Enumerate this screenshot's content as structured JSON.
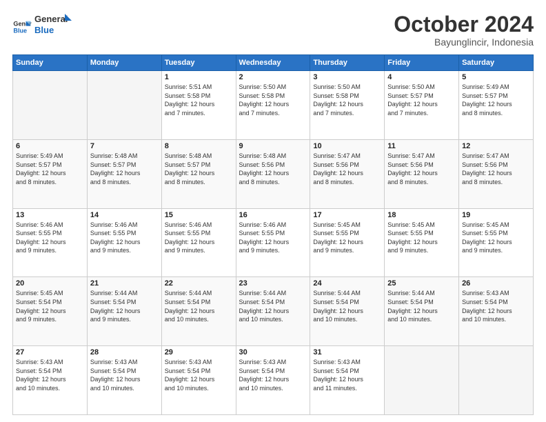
{
  "header": {
    "logo_line1": "General",
    "logo_line2": "Blue",
    "month": "October 2024",
    "location": "Bayunglincir, Indonesia"
  },
  "days_of_week": [
    "Sunday",
    "Monday",
    "Tuesday",
    "Wednesday",
    "Thursday",
    "Friday",
    "Saturday"
  ],
  "weeks": [
    [
      {
        "day": "",
        "info": ""
      },
      {
        "day": "",
        "info": ""
      },
      {
        "day": "1",
        "info": "Sunrise: 5:51 AM\nSunset: 5:58 PM\nDaylight: 12 hours\nand 7 minutes."
      },
      {
        "day": "2",
        "info": "Sunrise: 5:50 AM\nSunset: 5:58 PM\nDaylight: 12 hours\nand 7 minutes."
      },
      {
        "day": "3",
        "info": "Sunrise: 5:50 AM\nSunset: 5:58 PM\nDaylight: 12 hours\nand 7 minutes."
      },
      {
        "day": "4",
        "info": "Sunrise: 5:50 AM\nSunset: 5:57 PM\nDaylight: 12 hours\nand 7 minutes."
      },
      {
        "day": "5",
        "info": "Sunrise: 5:49 AM\nSunset: 5:57 PM\nDaylight: 12 hours\nand 8 minutes."
      }
    ],
    [
      {
        "day": "6",
        "info": "Sunrise: 5:49 AM\nSunset: 5:57 PM\nDaylight: 12 hours\nand 8 minutes."
      },
      {
        "day": "7",
        "info": "Sunrise: 5:48 AM\nSunset: 5:57 PM\nDaylight: 12 hours\nand 8 minutes."
      },
      {
        "day": "8",
        "info": "Sunrise: 5:48 AM\nSunset: 5:57 PM\nDaylight: 12 hours\nand 8 minutes."
      },
      {
        "day": "9",
        "info": "Sunrise: 5:48 AM\nSunset: 5:56 PM\nDaylight: 12 hours\nand 8 minutes."
      },
      {
        "day": "10",
        "info": "Sunrise: 5:47 AM\nSunset: 5:56 PM\nDaylight: 12 hours\nand 8 minutes."
      },
      {
        "day": "11",
        "info": "Sunrise: 5:47 AM\nSunset: 5:56 PM\nDaylight: 12 hours\nand 8 minutes."
      },
      {
        "day": "12",
        "info": "Sunrise: 5:47 AM\nSunset: 5:56 PM\nDaylight: 12 hours\nand 8 minutes."
      }
    ],
    [
      {
        "day": "13",
        "info": "Sunrise: 5:46 AM\nSunset: 5:55 PM\nDaylight: 12 hours\nand 9 minutes."
      },
      {
        "day": "14",
        "info": "Sunrise: 5:46 AM\nSunset: 5:55 PM\nDaylight: 12 hours\nand 9 minutes."
      },
      {
        "day": "15",
        "info": "Sunrise: 5:46 AM\nSunset: 5:55 PM\nDaylight: 12 hours\nand 9 minutes."
      },
      {
        "day": "16",
        "info": "Sunrise: 5:46 AM\nSunset: 5:55 PM\nDaylight: 12 hours\nand 9 minutes."
      },
      {
        "day": "17",
        "info": "Sunrise: 5:45 AM\nSunset: 5:55 PM\nDaylight: 12 hours\nand 9 minutes."
      },
      {
        "day": "18",
        "info": "Sunrise: 5:45 AM\nSunset: 5:55 PM\nDaylight: 12 hours\nand 9 minutes."
      },
      {
        "day": "19",
        "info": "Sunrise: 5:45 AM\nSunset: 5:55 PM\nDaylight: 12 hours\nand 9 minutes."
      }
    ],
    [
      {
        "day": "20",
        "info": "Sunrise: 5:45 AM\nSunset: 5:54 PM\nDaylight: 12 hours\nand 9 minutes."
      },
      {
        "day": "21",
        "info": "Sunrise: 5:44 AM\nSunset: 5:54 PM\nDaylight: 12 hours\nand 9 minutes."
      },
      {
        "day": "22",
        "info": "Sunrise: 5:44 AM\nSunset: 5:54 PM\nDaylight: 12 hours\nand 10 minutes."
      },
      {
        "day": "23",
        "info": "Sunrise: 5:44 AM\nSunset: 5:54 PM\nDaylight: 12 hours\nand 10 minutes."
      },
      {
        "day": "24",
        "info": "Sunrise: 5:44 AM\nSunset: 5:54 PM\nDaylight: 12 hours\nand 10 minutes."
      },
      {
        "day": "25",
        "info": "Sunrise: 5:44 AM\nSunset: 5:54 PM\nDaylight: 12 hours\nand 10 minutes."
      },
      {
        "day": "26",
        "info": "Sunrise: 5:43 AM\nSunset: 5:54 PM\nDaylight: 12 hours\nand 10 minutes."
      }
    ],
    [
      {
        "day": "27",
        "info": "Sunrise: 5:43 AM\nSunset: 5:54 PM\nDaylight: 12 hours\nand 10 minutes."
      },
      {
        "day": "28",
        "info": "Sunrise: 5:43 AM\nSunset: 5:54 PM\nDaylight: 12 hours\nand 10 minutes."
      },
      {
        "day": "29",
        "info": "Sunrise: 5:43 AM\nSunset: 5:54 PM\nDaylight: 12 hours\nand 10 minutes."
      },
      {
        "day": "30",
        "info": "Sunrise: 5:43 AM\nSunset: 5:54 PM\nDaylight: 12 hours\nand 10 minutes."
      },
      {
        "day": "31",
        "info": "Sunrise: 5:43 AM\nSunset: 5:54 PM\nDaylight: 12 hours\nand 11 minutes."
      },
      {
        "day": "",
        "info": ""
      },
      {
        "day": "",
        "info": ""
      }
    ]
  ]
}
